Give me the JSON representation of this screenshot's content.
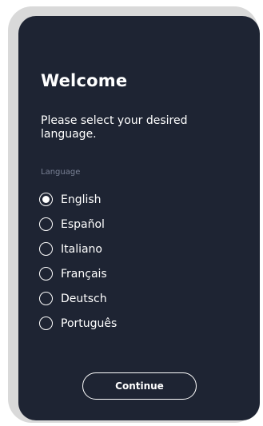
{
  "welcome": {
    "title": "Welcome",
    "subtitle": "Please select your desired language."
  },
  "language": {
    "label": "Language",
    "selected": "English",
    "options": [
      {
        "label": "English",
        "selected": true
      },
      {
        "label": "Español",
        "selected": false
      },
      {
        "label": "Italiano",
        "selected": false
      },
      {
        "label": "Français",
        "selected": false
      },
      {
        "label": "Deutsch",
        "selected": false
      },
      {
        "label": "Português",
        "selected": false
      }
    ]
  },
  "actions": {
    "continue_label": "Continue"
  },
  "colors": {
    "screen_background": "#1e2433",
    "device_frame": "#d9d9d9",
    "text_primary": "#ffffff",
    "text_muted": "#7a8296"
  }
}
